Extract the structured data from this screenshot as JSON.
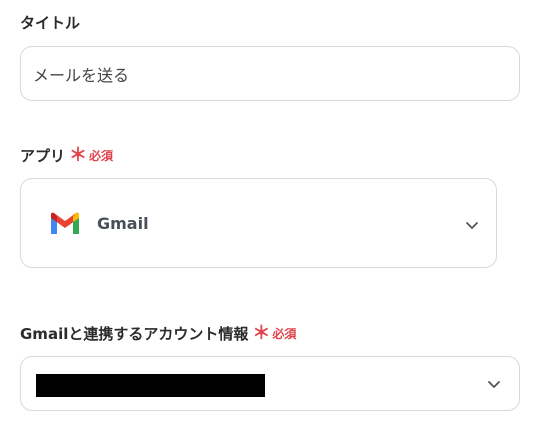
{
  "title_field": {
    "label": "タイトル",
    "value": "メールを送る"
  },
  "app_field": {
    "label": "アプリ",
    "required_mark": "＊",
    "required_text": "必須",
    "selected_app": "Gmail",
    "app_icon": "gmail-logo-icon"
  },
  "account_field": {
    "label": "Gmailと連携するアカウント情報",
    "required_mark": "＊",
    "required_text": "必須",
    "selected_value": "",
    "redacted": true
  },
  "colors": {
    "required": "#e0434c",
    "border": "#d7d9de",
    "label": "#2b2b2b"
  }
}
